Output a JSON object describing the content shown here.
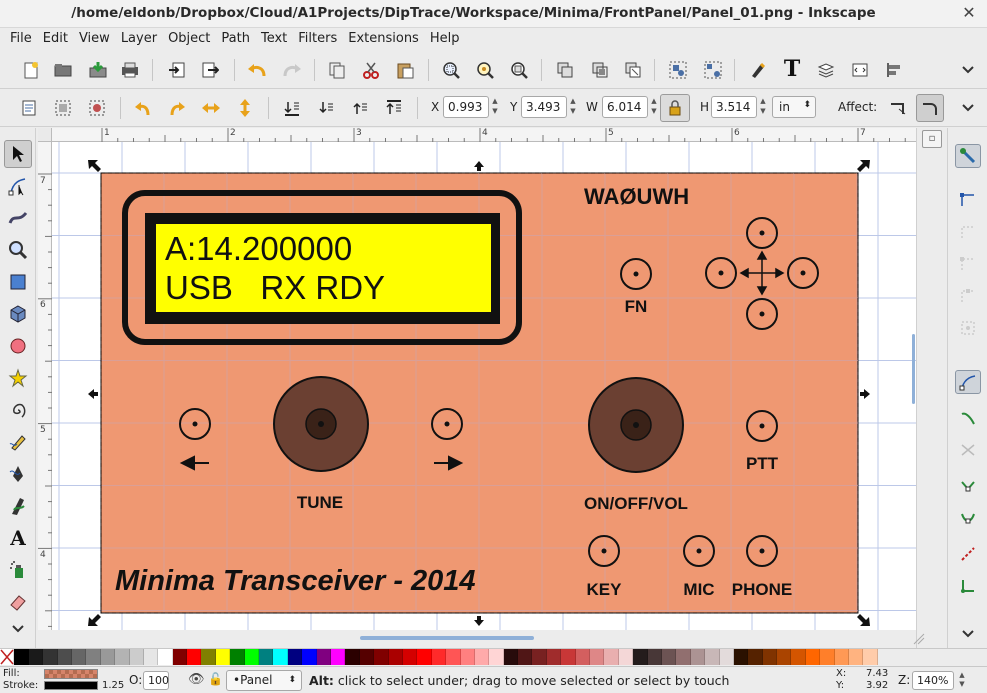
{
  "window": {
    "title": "/home/eldonb/Dropbox/Cloud/A1Projects/DipTrace/Workspace/Minima/FrontPanel/Panel_01.png - Inkscape",
    "close_glyph": "✕"
  },
  "menu": [
    "File",
    "Edit",
    "View",
    "Layer",
    "Object",
    "Path",
    "Text",
    "Filters",
    "Extensions",
    "Help"
  ],
  "toolbar_controls": {
    "x_label": "X",
    "x_value": "0.993",
    "y_label": "Y",
    "y_value": "3.493",
    "w_label": "W",
    "w_value": "6.014",
    "h_label": "H",
    "h_value": "3.514",
    "unit": "in",
    "affect_label": "Affect:"
  },
  "icons": {
    "new": "new-document-icon",
    "open": "open-icon",
    "save": "save-icon",
    "print": "print-icon",
    "import": "import-icon",
    "export": "export-icon",
    "undo": "undo-icon",
    "redo": "redo-icon",
    "copy": "copy-icon",
    "cut": "cut-icon",
    "paste": "paste-icon",
    "zoom_selection": "zoom-selection-icon",
    "zoom_drawing": "zoom-drawing-icon",
    "zoom_page": "zoom-page-icon",
    "duplicate": "duplicate-icon",
    "clone": "clone-icon",
    "unlink": "unlink-clone-icon",
    "group": "group-icon",
    "ungroup": "ungroup-icon",
    "fill_stroke": "fill-stroke-icon",
    "text_font": "text-font-icon",
    "layers": "layers-icon",
    "xml_editor": "xml-editor-icon",
    "align": "align-icon",
    "more": "chevron-down-icon"
  },
  "rulers": {
    "horizontal": [
      "1",
      "2",
      "3",
      "4",
      "5",
      "6",
      "7"
    ],
    "vertical": [
      "7",
      "6",
      "5",
      "4"
    ]
  },
  "panel": {
    "background": "#ef9872",
    "lcd_line1": "A:14.200000",
    "lcd_line2": "USB   RX RDY",
    "callsign": "WAØUWH",
    "label_fn": "FN",
    "label_tune": "TUNE",
    "label_vol": "ON/OFF/VOL",
    "label_ptt": "PTT",
    "label_key": "KEY",
    "label_mic": "MIC",
    "label_phone": "PHONE",
    "footer": "Minima Transceiver - 2014",
    "knob_color": "#6b4032",
    "lcd_color": "#ffff00"
  },
  "status": {
    "fill_label": "Fill:",
    "stroke_label": "Stroke:",
    "stroke_width": "1.25",
    "opacity_label": "O:",
    "opacity_value": "100",
    "layer": "•Panel",
    "message_key": "Alt:",
    "message": " click to select under; drag to move selected or select by touch",
    "x_label": "X:",
    "x_value": "7.43",
    "y_label": "Y:",
    "y_value": "3.92",
    "zoom_label": "Z:",
    "zoom_value": "140%"
  },
  "palette": [
    "#000000",
    "#1a1a1a",
    "#333333",
    "#4d4d4d",
    "#666666",
    "#808080",
    "#999999",
    "#b3b3b3",
    "#cccccc",
    "#e6e6e6",
    "#ffffff",
    "#800000",
    "#ff0000",
    "#808000",
    "#ffff00",
    "#008000",
    "#00ff00",
    "#008080",
    "#00ffff",
    "#000080",
    "#0000ff",
    "#800080",
    "#ff00ff",
    "#2b0000",
    "#550000",
    "#800000",
    "#aa0000",
    "#d40000",
    "#ff0000",
    "#ff2a2a",
    "#ff5555",
    "#ff8080",
    "#ffaaaa",
    "#ffd5d5",
    "#280b0b",
    "#501616",
    "#782121",
    "#a02c2c",
    "#c83737",
    "#d35f5f",
    "#de8787",
    "#e9afaf",
    "#f4d7d7",
    "#241c1c",
    "#483737",
    "#6c5353",
    "#916f6f",
    "#ac9393",
    "#c8b7b7",
    "#e3dbdb",
    "#2b1100",
    "#552200",
    "#803300",
    "#aa4400",
    "#d45500",
    "#ff6600",
    "#ff7f2a",
    "#ff9955",
    "#ffb380",
    "#ffccaa"
  ]
}
